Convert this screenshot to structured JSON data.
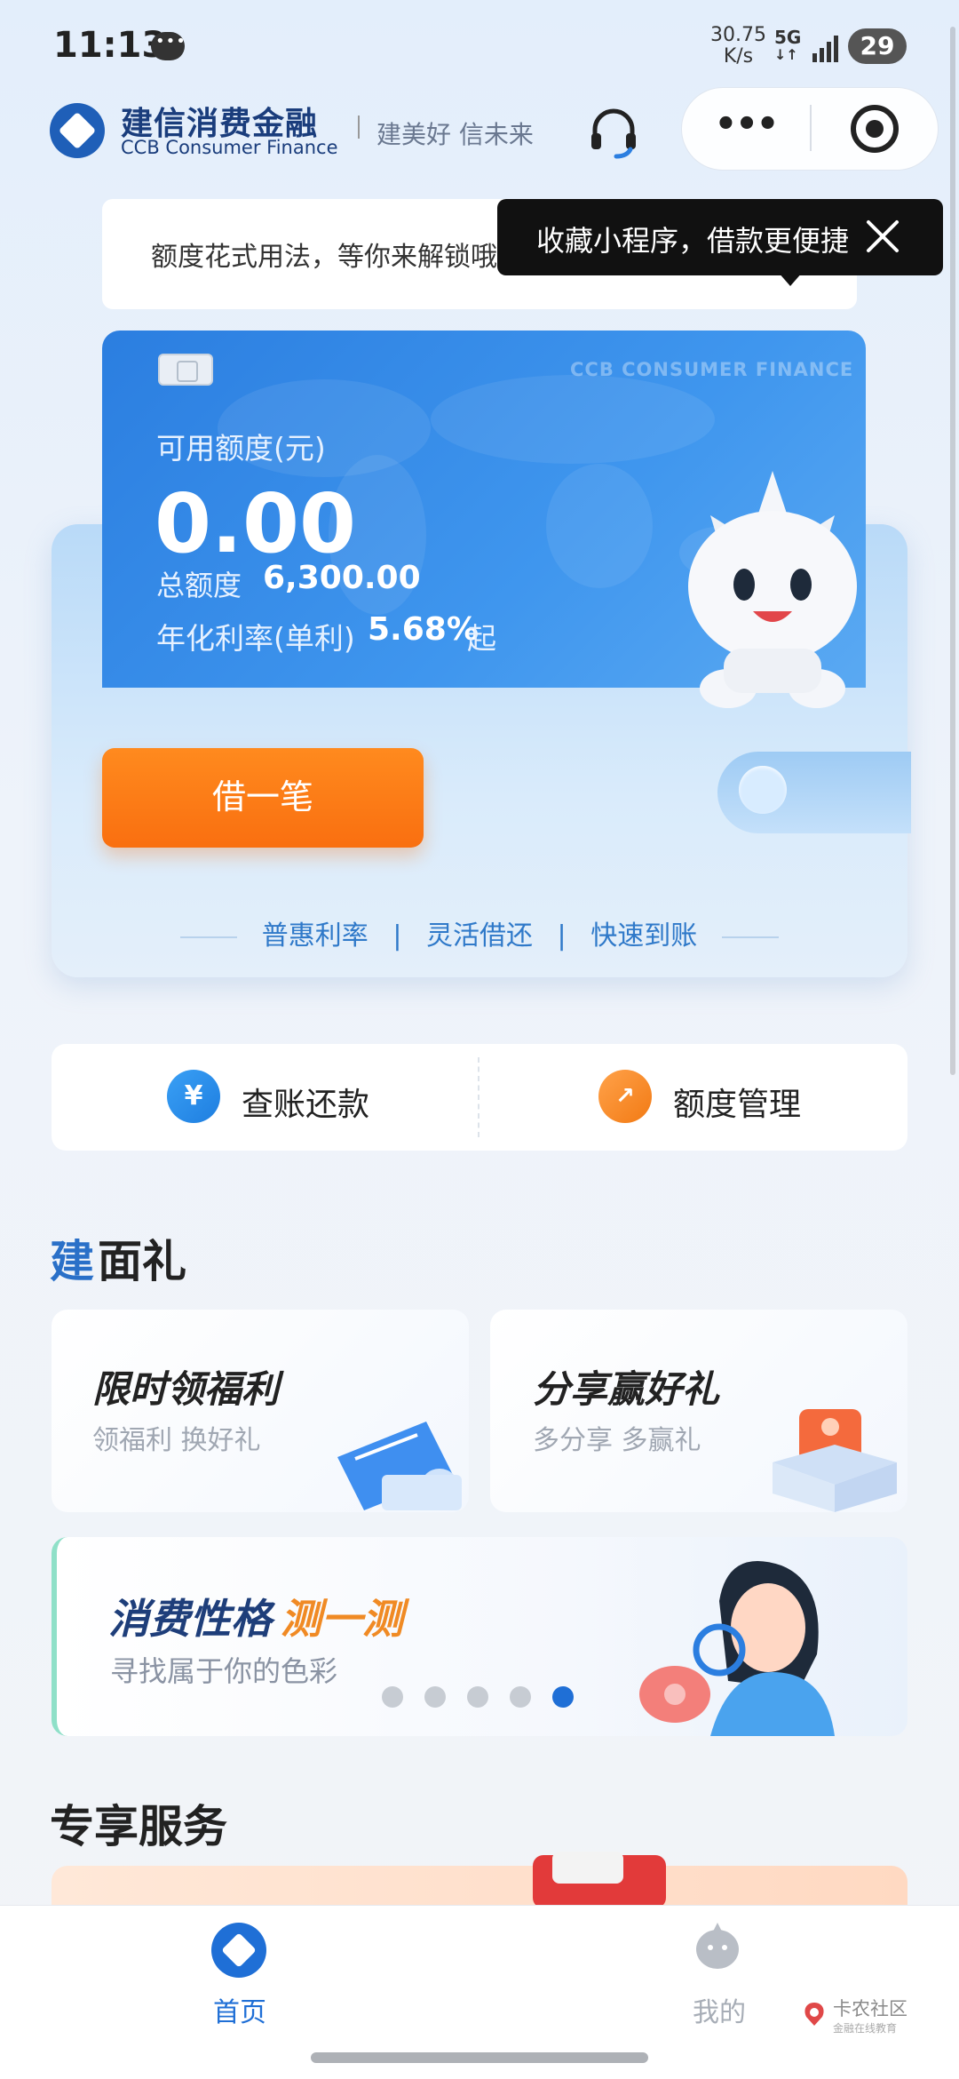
{
  "status_bar": {
    "time": "11:13",
    "speed_value": "30.75",
    "speed_unit": "K/s",
    "network": "5G",
    "battery": "29"
  },
  "header": {
    "brand_cn": "建信消费金融",
    "brand_en": "CCB Consumer Finance",
    "slogan": "建美好 信未来",
    "capsule_more": "•••"
  },
  "notice": {
    "text": "额度花式用法，等你来解锁哦"
  },
  "tooltip": {
    "text": "收藏小程序，借款更便捷"
  },
  "card": {
    "brand_text": "CCB CONSUMER FINANCE",
    "available_label": "可用额度(元)",
    "available_amount": "0.00",
    "total_label": "总额度",
    "total_value": "6,300.00",
    "rate_label": "年化利率(单利)",
    "rate_value": "5.68%",
    "rate_suffix": "起",
    "borrow_button": "借一笔",
    "features": [
      "普惠利率",
      "灵活借还",
      "快速到账"
    ]
  },
  "quick_actions": {
    "bill": {
      "icon": "¥",
      "label": "查账还款"
    },
    "quota": {
      "label": "额度管理"
    }
  },
  "gift_section": {
    "title_first": "建",
    "title_rest": "面礼",
    "cards": [
      {
        "title": "限时领福利",
        "subtitle": "领福利 换好礼"
      },
      {
        "title": "分享赢好礼",
        "subtitle": "多分享 多赢礼"
      }
    ]
  },
  "banner": {
    "title_a": "消费性格",
    "title_b": "测一测",
    "subtitle": "寻找属于你的色彩",
    "dots_total": 5,
    "dots_active_index": 4
  },
  "exclusive": {
    "title": "专享服务"
  },
  "bottom_nav": {
    "home_label": "首页",
    "me_label": "我的"
  },
  "watermark": {
    "text": "卡农社区",
    "sub": "金融在线教育"
  },
  "colors": {
    "brand_blue": "#1f6fd6",
    "accent_orange": "#f96f10",
    "card_blue": "#2b7ee0"
  }
}
